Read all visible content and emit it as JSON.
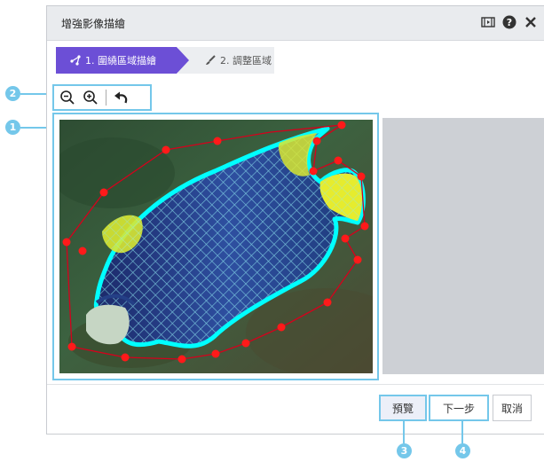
{
  "dialog": {
    "title": "增強影像描繪"
  },
  "steps": [
    {
      "label": "1. 圍繞區域描繪"
    },
    {
      "label": "2. 調整區域"
    }
  ],
  "buttons": {
    "preview": "預覽",
    "next": "下一步",
    "cancel": "取消"
  },
  "callouts": {
    "one": "1",
    "two": "2",
    "three": "3",
    "four": "4"
  },
  "colors": {
    "accent": "#6c4fd6",
    "callout": "#74c7ea",
    "outline": "#d6001c",
    "mask": "#00ffff"
  }
}
